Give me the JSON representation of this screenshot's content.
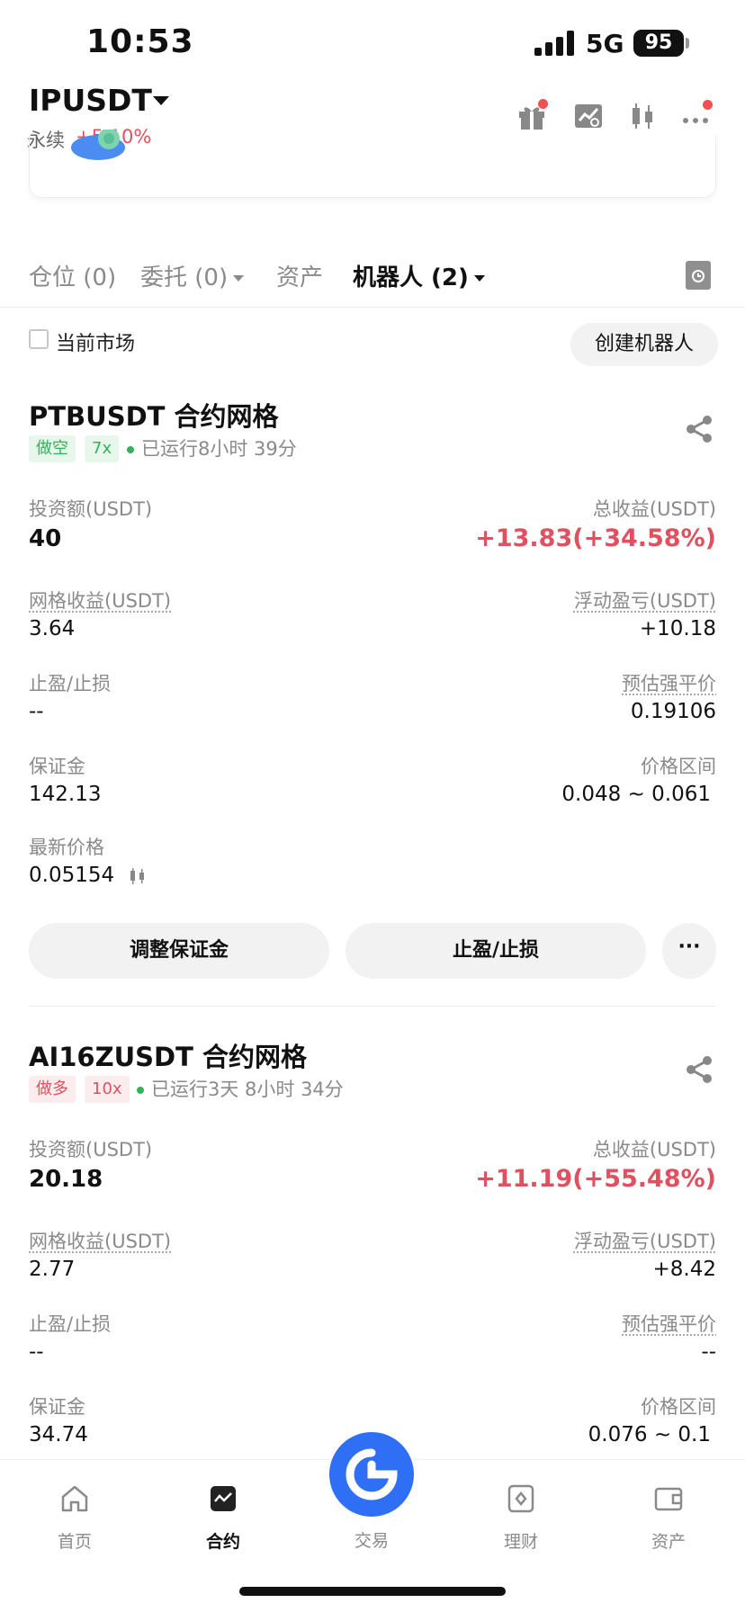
{
  "status_bar": {
    "time": "10:53",
    "network": "5G",
    "battery": "95"
  },
  "header": {
    "pair": "IPUSDT",
    "contract_type": "永续",
    "change": "+5.10%",
    "icons": [
      "gift-icon",
      "chart-bot-icon",
      "candlestick-icon",
      "more-icon"
    ]
  },
  "tabs": [
    {
      "label": "仓位 (0)"
    },
    {
      "label": "委托 (0)"
    },
    {
      "label": "资产"
    },
    {
      "label": "机器人 (2)"
    }
  ],
  "filter": {
    "label": "当前市场",
    "create_button": "创建机器人"
  },
  "bots": [
    {
      "title": "PTBUSDT 合约网格",
      "side": "做空",
      "leverage": "7x",
      "runtime": "已运行8小时 39分",
      "investment_label": "投资额(USDT)",
      "investment": "40",
      "total_pnl_label": "总收益(USDT)",
      "total_pnl": "+13.83(+34.58%)",
      "grid_profit_label": "网格收益(USDT)",
      "grid_profit": "3.64",
      "floating_pnl_label": "浮动盈亏(USDT)",
      "floating_pnl": "+10.18",
      "tpsl_label": "止盈/止损",
      "tpsl": "--",
      "liq_label": "预估强平价",
      "liq": "0.19106",
      "margin_label": "保证金",
      "margin": "142.13",
      "range_label": "价格区间",
      "range": "0.048 ~ 0.061",
      "last_price_label": "最新价格",
      "last_price": "0.05154",
      "adjust_margin_button": "调整保证金",
      "tpsl_button": "止盈/止损",
      "more_button": "···"
    },
    {
      "title": "AI16ZUSDT 合约网格",
      "side": "做多",
      "leverage": "10x",
      "runtime": "已运行3天 8小时 34分",
      "investment_label": "投资额(USDT)",
      "investment": "20.18",
      "total_pnl_label": "总收益(USDT)",
      "total_pnl": "+11.19(+55.48%)",
      "grid_profit_label": "网格收益(USDT)",
      "grid_profit": "2.77",
      "floating_pnl_label": "浮动盈亏(USDT)",
      "floating_pnl": "+8.42",
      "tpsl_label": "止盈/止损",
      "tpsl": "--",
      "liq_label": "预估强平价",
      "liq": "--",
      "margin_label": "保证金",
      "margin": "34.74",
      "range_label": "价格区间",
      "range": "0.076 ~ 0.1"
    }
  ],
  "bottom_nav": [
    {
      "label": "首页",
      "icon": "home-icon"
    },
    {
      "label": "合约",
      "icon": "futures-icon"
    },
    {
      "label": "交易",
      "icon": "trade-icon"
    },
    {
      "label": "理财",
      "icon": "earn-icon"
    },
    {
      "label": "资产",
      "icon": "wallet-icon"
    }
  ],
  "colors": {
    "red": "#e0505e",
    "green": "#34b257",
    "accent": "#2f6ff5"
  }
}
